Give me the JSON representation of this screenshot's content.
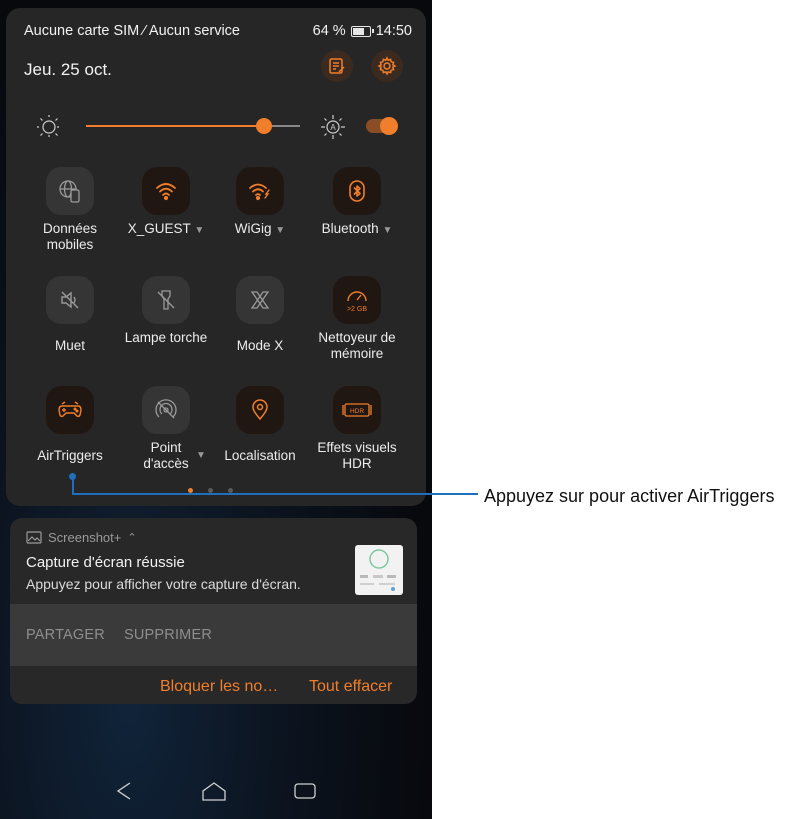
{
  "status": {
    "carrier": "Aucune carte SIM ⁄ Aucun service",
    "battery": "64 %",
    "battery_fraction": 0.64,
    "time": "14:50"
  },
  "header": {
    "date": "Jeu. 25 oct.",
    "edit_icon": "edit-notes-icon",
    "settings_icon": "gear-icon"
  },
  "brightness": {
    "level_fraction": 0.83,
    "auto_enabled": true
  },
  "tiles": [
    {
      "label": "Données mobiles",
      "icon": "mobile-data-icon",
      "active": false,
      "has_dropdown": false
    },
    {
      "label": "X_GUEST",
      "icon": "wifi-icon",
      "active": true,
      "has_dropdown": true
    },
    {
      "label": "WiGig",
      "icon": "wigig-icon",
      "active": true,
      "has_dropdown": true
    },
    {
      "label": "Bluetooth",
      "icon": "bluetooth-icon",
      "active": true,
      "has_dropdown": true
    },
    {
      "label": "Muet",
      "icon": "mute-icon",
      "active": false,
      "has_dropdown": false
    },
    {
      "label": "Lampe torche",
      "icon": "flashlight-icon",
      "active": false,
      "has_dropdown": false
    },
    {
      "label": "Mode X",
      "icon": "x-mode-icon",
      "active": false,
      "has_dropdown": false
    },
    {
      "label": "Nettoyeur de mémoire",
      "icon": "memory-cleaner-icon",
      "active": true,
      "has_dropdown": false,
      "badge": ">2 GB"
    },
    {
      "label": "AirTriggers",
      "icon": "airtriggers-icon",
      "active": true,
      "has_dropdown": false
    },
    {
      "label": "Point d'accès",
      "icon": "hotspot-icon",
      "active": false,
      "has_dropdown": true
    },
    {
      "label": "Localisation",
      "icon": "location-icon",
      "active": true,
      "has_dropdown": false
    },
    {
      "label": "Effets visuels HDR",
      "icon": "hdr-icon",
      "active": true,
      "has_dropdown": false,
      "badge": "HDR"
    }
  ],
  "pager": {
    "pages": 3,
    "active": 0
  },
  "notification": {
    "app": "Screenshot+",
    "title": "Capture d'écran réussie",
    "body": "Appuyez pour afficher votre capture d'écran.",
    "actions": [
      "PARTAGER",
      "SUPPRIMER"
    ]
  },
  "footer": {
    "block": "Bloquer les no…",
    "clear": "Tout effacer"
  },
  "callout": {
    "text": "Appuyez sur pour activer AirTriggers"
  },
  "colors": {
    "accent": "#f07e2a",
    "callout_line": "#1f6fbf",
    "panel": "#262626"
  }
}
